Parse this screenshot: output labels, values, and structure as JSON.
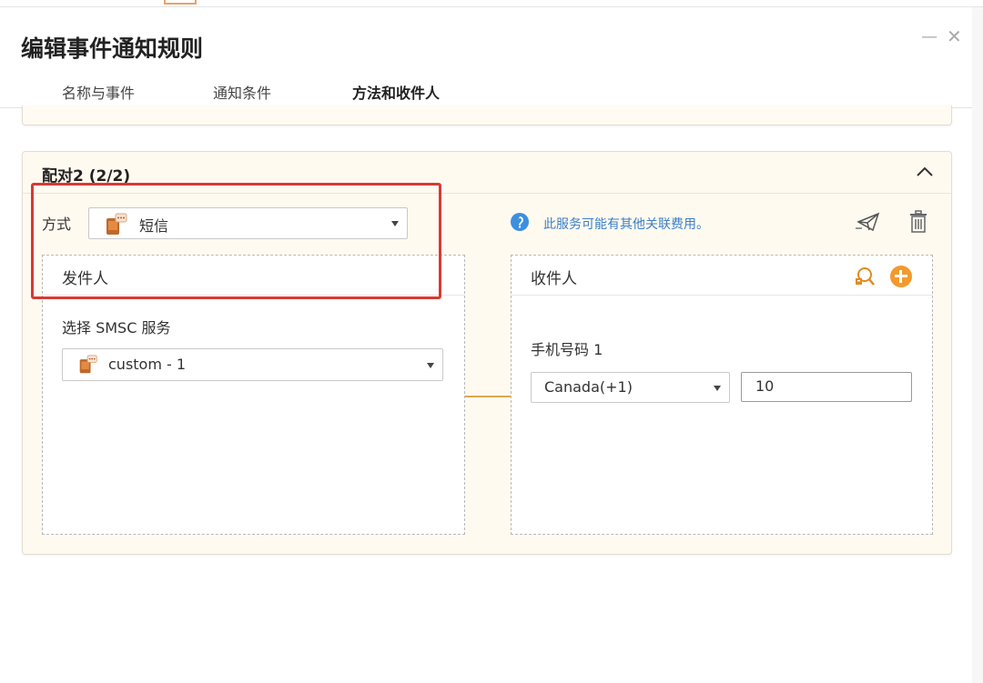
{
  "dialog": {
    "title": "编辑事件通知规则",
    "window_controls": {
      "minimize": "—",
      "close": "✕"
    }
  },
  "tabs": [
    {
      "label": "名称与事件",
      "active": false
    },
    {
      "label": "通知条件",
      "active": false
    },
    {
      "label": "方法和收件人",
      "active": true
    }
  ],
  "pair": {
    "title": "配对2 (2/2)",
    "method": {
      "label": "方式",
      "selected": "短信",
      "icon": "sms-icon"
    },
    "notice": {
      "text": "此服务可能有其他关联费用。",
      "icon": "info-icon"
    },
    "sender": {
      "header": "发件人",
      "smsc_label": "选择 SMSC 服务",
      "smsc_selected": "custom - 1"
    },
    "recipient": {
      "header": "收件人",
      "phone_label": "手机号码 1",
      "country_selected": "Canada(+1)",
      "phone_value": "10"
    }
  },
  "colors": {
    "accent_orange": "#f29a2e",
    "info_blue": "#3a7fc8",
    "highlight_red": "#d73a33",
    "card_background": "#fffaf0"
  }
}
